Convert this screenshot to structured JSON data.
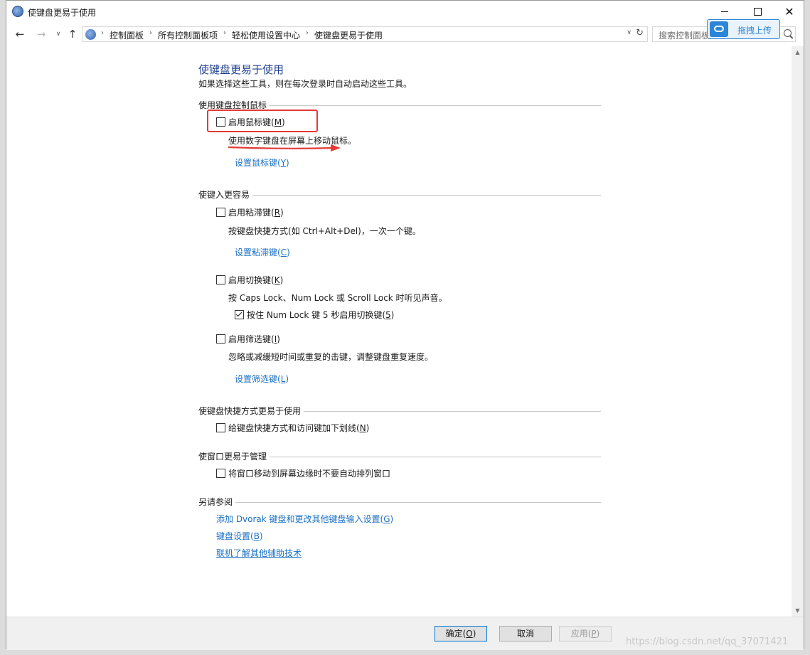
{
  "window": {
    "title": "使键盘更易于使用",
    "controls": {
      "minimize": "—",
      "maximize": "□",
      "close": "✕"
    }
  },
  "nav": {
    "back": "←",
    "forward": "→",
    "recent": "∨",
    "up": "↑",
    "breadcrumbs": [
      "控制面板",
      "所有控制面板项",
      "轻松使用设置中心",
      "使键盘更易于使用"
    ],
    "separator": "›",
    "dropdown": "∨",
    "refresh": "↻",
    "search_placeholder": "搜索控制面板",
    "upload_button": "拖拽上传"
  },
  "page": {
    "title": "使键盘更易于使用",
    "description": "如果选择这些工具，则在每次登录时自动启动这些工具。"
  },
  "sections": {
    "mouse": {
      "title": "使用键盘控制鼠标",
      "mouse_keys_label": "启用鼠标键(",
      "mouse_keys_key": "M",
      "mouse_keys_checked": false,
      "mouse_keys_desc": "使用数字键盘在屏幕上移动鼠标。",
      "mouse_keys_link": "设置鼠标键(",
      "mouse_keys_link_key": "Y"
    },
    "typing": {
      "title": "使键入更容易",
      "sticky_label": "启用粘滞键(",
      "sticky_key": "R",
      "sticky_checked": false,
      "sticky_desc": "按键盘快捷方式(如 Ctrl+Alt+Del)，一次一个键。",
      "sticky_link": "设置粘滞键(",
      "sticky_link_key": "C",
      "toggle_label": "启用切换键(",
      "toggle_key": "K",
      "toggle_checked": false,
      "toggle_desc": "按 Caps Lock、Num Lock 或 Scroll Lock 时听见声音。",
      "toggle_hold_label": "按住 Num Lock 键 5 秒启用切换键(",
      "toggle_hold_key": "5",
      "toggle_hold_checked": true,
      "filter_label": "启用筛选键(",
      "filter_key": "I",
      "filter_checked": false,
      "filter_desc": "忽略或减缓短时间或重复的击键，调整键盘重复速度。",
      "filter_link": "设置筛选键(",
      "filter_link_key": "L"
    },
    "shortcuts": {
      "title": "使键盘快捷方式更易于使用",
      "underline_label": "给键盘快捷方式和访问键加下划线(",
      "underline_key": "N",
      "underline_checked": false
    },
    "windows": {
      "title": "使窗口更易于管理",
      "snap_label": "将窗口移动到屏幕边缘时不要自动排列窗口",
      "snap_checked": false
    },
    "see_also": {
      "title": "另请参阅",
      "link_dvorak": "添加 Dvorak 键盘和更改其他键盘输入设置(",
      "link_dvorak_key": "G",
      "link_keyboard": "键盘设置(",
      "link_keyboard_key": "B",
      "link_online": "联机了解其他辅助技术"
    }
  },
  "buttons": {
    "ok": "确定(",
    "ok_key": "O",
    "cancel": "取消",
    "apply": "应用(",
    "apply_key": "P",
    "close_paren": ")"
  },
  "watermark": "https://blog.csdn.net/qq_37071421",
  "colors": {
    "link": "#1a6fc4",
    "title": "#1e3f8f",
    "annotation": "#e53935",
    "upload_accent": "#2b86d9"
  }
}
